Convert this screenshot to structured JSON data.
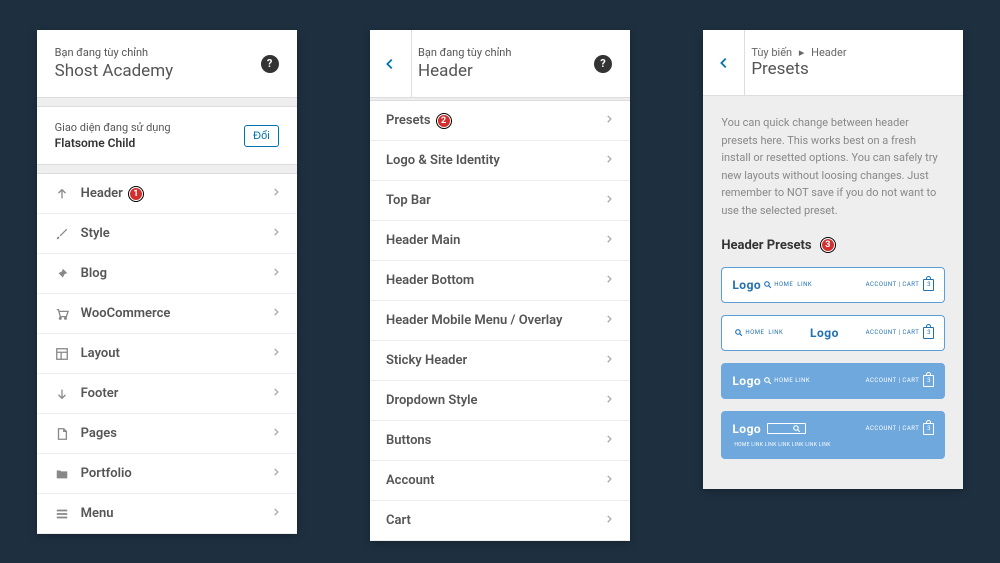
{
  "panel1": {
    "subtitle": "Bạn đang tùy chỉnh",
    "title": "Shost Academy",
    "theme_label": "Giao diện đang sử dụng",
    "theme_name": "Flatsome Child",
    "change_button": "Đổi",
    "items": [
      {
        "label": "Header",
        "icon": "arrow-up",
        "badge": "1"
      },
      {
        "label": "Style",
        "icon": "paintbrush"
      },
      {
        "label": "Blog",
        "icon": "pushpin"
      },
      {
        "label": "WooCommerce",
        "icon": "cart"
      },
      {
        "label": "Layout",
        "icon": "layout"
      },
      {
        "label": "Footer",
        "icon": "arrow-down"
      },
      {
        "label": "Pages",
        "icon": "page"
      },
      {
        "label": "Portfolio",
        "icon": "folder"
      },
      {
        "label": "Menu",
        "icon": "menu"
      }
    ]
  },
  "panel2": {
    "subtitle": "Bạn đang tùy chỉnh",
    "title": "Header",
    "items": [
      {
        "label": "Presets",
        "badge": "2"
      },
      {
        "label": "Logo & Site Identity"
      },
      {
        "label": "Top Bar"
      },
      {
        "label": "Header Main"
      },
      {
        "label": "Header Bottom"
      },
      {
        "label": "Header Mobile Menu / Overlay"
      },
      {
        "label": "Sticky Header"
      },
      {
        "label": "Dropdown Style"
      },
      {
        "label": "Buttons"
      },
      {
        "label": "Account"
      },
      {
        "label": "Cart"
      }
    ]
  },
  "panel3": {
    "breadcrumb_parent": "Tùy biến",
    "breadcrumb_current": "Header",
    "title": "Presets",
    "description": "You can quick change between header presets here. This works best on a fresh install or resetted options. You can safely try new layouts without loosing changes. Just remember to NOT save if you do not want to use the selected preset.",
    "heading": "Header Presets",
    "heading_badge": "3",
    "presets": {
      "logo": "Logo",
      "home": "HOME",
      "link": "LINK",
      "account_cart": "ACCOUNT | CART",
      "home_link": "HOME LINK",
      "sub_nav": "HOME LINK     LINK LINK LINK LINK LINK",
      "bag_count": "3"
    }
  }
}
